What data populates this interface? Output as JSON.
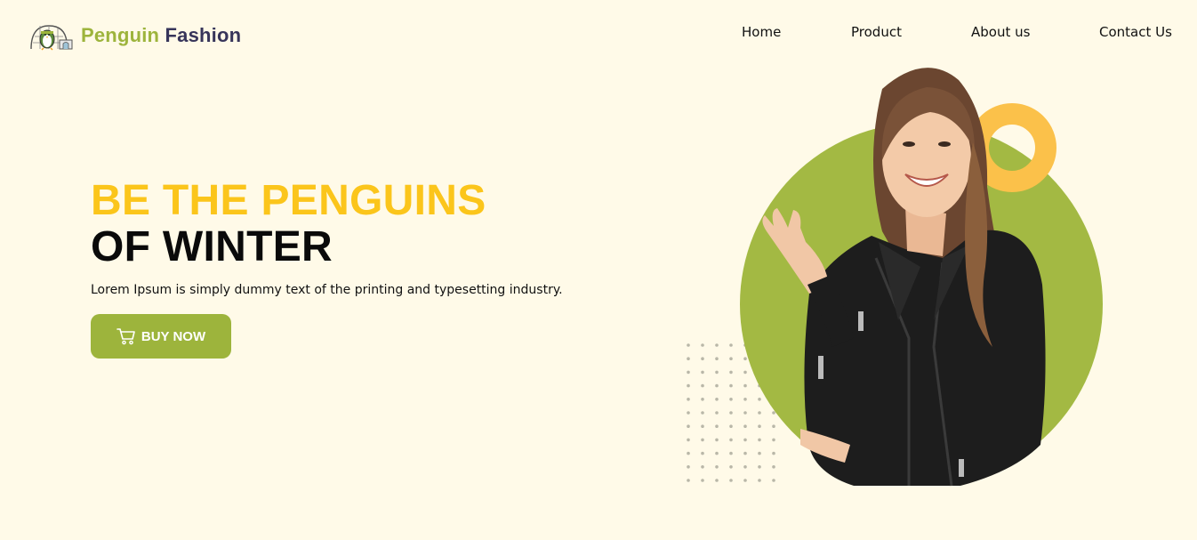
{
  "header": {
    "brand_part1": "Penguin",
    "brand_part2": "Fashion",
    "logo_icon": "penguin-igloo-icon"
  },
  "nav": {
    "items": [
      "Home",
      "Product",
      "About us",
      "Contact Us"
    ]
  },
  "hero": {
    "headline_line1": "BE THE PENGUINS",
    "headline_line2": "OF WINTER",
    "subtext": "Lorem Ipsum is simply dummy text of the printing and typesetting industry.",
    "cta_label": "BUY NOW",
    "cta_icon": "cart-icon"
  },
  "colors": {
    "background": "#fffae8",
    "accent_green": "#9db43c",
    "accent_yellow": "#fbc51b",
    "brand_dark": "#37355a",
    "ring": "#fbc14a",
    "circle_green": "#a3b943"
  }
}
